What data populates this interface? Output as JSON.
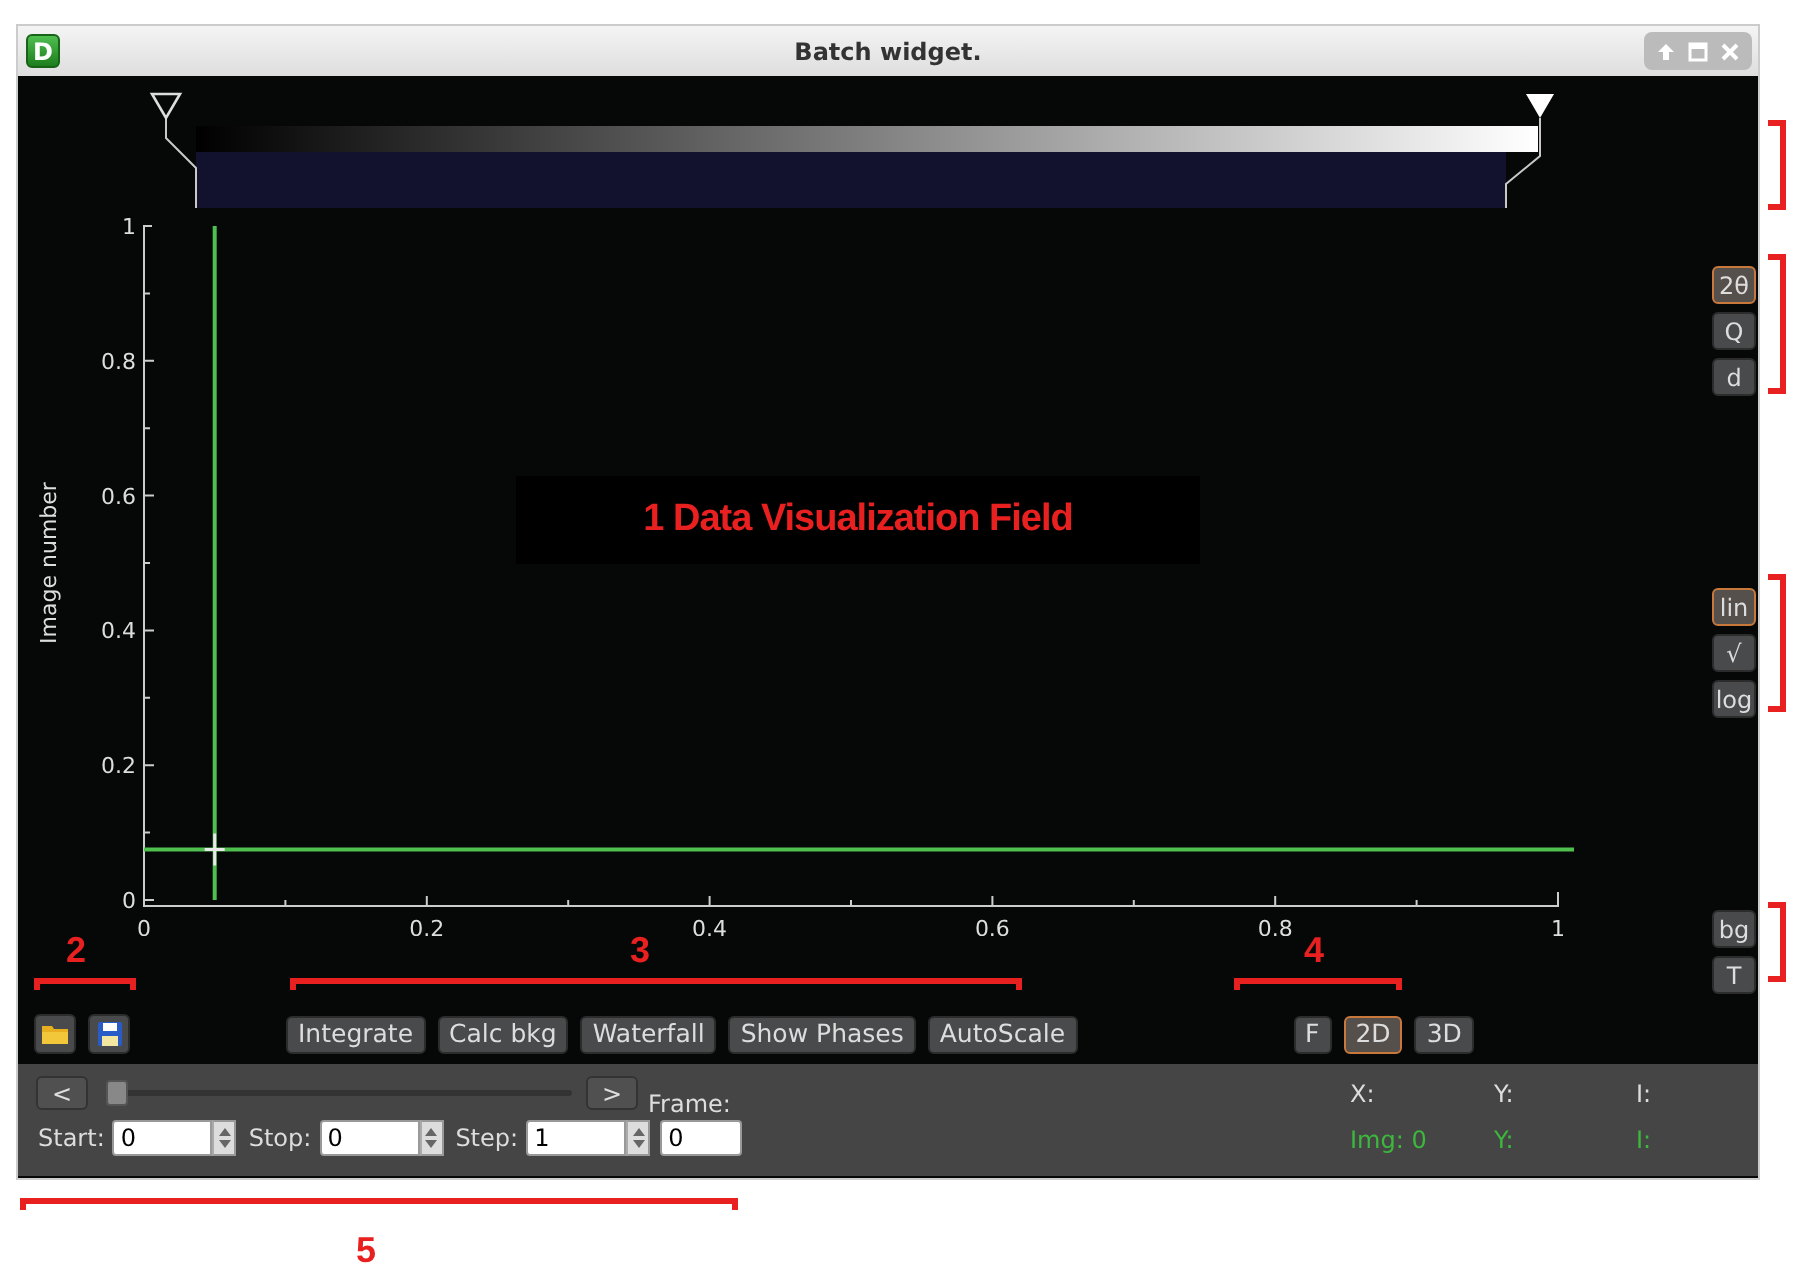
{
  "window": {
    "app_icon": "D",
    "title": "Batch widget."
  },
  "color_scale": {
    "min_marker": {
      "level": 0
    },
    "max_marker": {
      "level": 1
    }
  },
  "plot": {
    "chart_data": {
      "type": "line",
      "ylabel": "Image number",
      "xlim": [
        0,
        1
      ],
      "ylim": [
        0,
        1
      ],
      "xticks": [
        0,
        0.2,
        0.4,
        0.6,
        0.8,
        1
      ],
      "yticks": [
        0,
        0.2,
        0.4,
        0.6,
        0.8,
        1
      ],
      "ref_lines": [
        {
          "axis": "x",
          "value": 0.05
        },
        {
          "axis": "y",
          "value": 0.075
        }
      ]
    }
  },
  "axis_units": [
    {
      "label": "2θ",
      "selected": true
    },
    {
      "label": "Q",
      "selected": false
    },
    {
      "label": "d",
      "selected": false
    }
  ],
  "scales": [
    {
      "label": "lin",
      "selected": true
    },
    {
      "label": "√",
      "selected": false
    },
    {
      "label": "log",
      "selected": false
    }
  ],
  "extra_buttons": [
    "bg",
    "T"
  ],
  "action_buttons": [
    "Integrate",
    "Calc bkg",
    "Waterfall",
    "Show Phases",
    "AutoScale"
  ],
  "view_modes": [
    {
      "label": "F",
      "selected": false
    },
    {
      "label": "2D",
      "selected": true
    },
    {
      "label": "3D",
      "selected": false
    }
  ],
  "navigation": {
    "prev": "<",
    "next": ">",
    "slider": {
      "level": 0
    },
    "frame": {
      "label": "Frame:",
      "value": "0"
    },
    "start": {
      "label": "Start:",
      "value": "0"
    },
    "stop": {
      "label": "Stop:",
      "value": "0"
    },
    "step": {
      "label": "Step:",
      "value": "1"
    }
  },
  "readout": {
    "row_1": [
      "X:",
      "Y:",
      "I:"
    ],
    "row_2": [
      "Img: 0",
      "Y:",
      "I:"
    ]
  },
  "annotations": {
    "overlay_label": "1 Data Visualization Field",
    "markers": [
      "2",
      "3",
      "4",
      "5"
    ]
  }
}
